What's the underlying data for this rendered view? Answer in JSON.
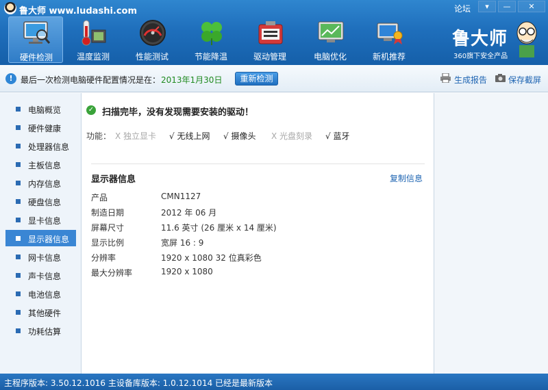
{
  "app": {
    "title": "鲁大师 www.ludashi.com",
    "forum_link": "论坛",
    "menu_btn": "▾",
    "min_btn": "—",
    "close_btn": "✕"
  },
  "nav": {
    "items": [
      {
        "label": "硬件检测",
        "icon": "monitor-magnifier-icon",
        "active": true
      },
      {
        "label": "温度监测",
        "icon": "thermometer-icon",
        "active": false
      },
      {
        "label": "性能测试",
        "icon": "speedometer-icon",
        "active": false
      },
      {
        "label": "节能降温",
        "icon": "clover-icon",
        "active": false
      },
      {
        "label": "驱动管理",
        "icon": "driver-box-icon",
        "active": false
      },
      {
        "label": "电脑优化",
        "icon": "optimize-monitor-icon",
        "active": false
      },
      {
        "label": "新机推荐",
        "icon": "award-computer-icon",
        "active": false
      }
    ]
  },
  "brand": {
    "name": "鲁大师",
    "subtitle": "360旗下安全产品"
  },
  "infobar": {
    "text": "最后一次检测电脑硬件配置情况是在：",
    "date": "2013年1月30日",
    "recheck_button": "重新检测",
    "report_link": "生成报告",
    "screenshot_link": "保存截屏"
  },
  "sidebar": {
    "items": [
      {
        "label": "电脑概览",
        "active": false
      },
      {
        "label": "硬件健康",
        "active": false
      },
      {
        "label": "处理器信息",
        "active": false
      },
      {
        "label": "主板信息",
        "active": false
      },
      {
        "label": "内存信息",
        "active": false
      },
      {
        "label": "硬盘信息",
        "active": false
      },
      {
        "label": "显卡信息",
        "active": false
      },
      {
        "label": "显示器信息",
        "active": true
      },
      {
        "label": "网卡信息",
        "active": false
      },
      {
        "label": "声卡信息",
        "active": false
      },
      {
        "label": "电池信息",
        "active": false
      },
      {
        "label": "其他硬件",
        "active": false
      },
      {
        "label": "功耗估算",
        "active": false
      }
    ]
  },
  "main": {
    "scan_message": "扫描完毕，没有发现需要安装的驱动！",
    "features_label": "功能：",
    "features": [
      {
        "text": "X 独立显卡",
        "supported": false
      },
      {
        "text": "√ 无线上网",
        "supported": true
      },
      {
        "text": "√ 摄像头",
        "supported": true
      },
      {
        "text": "X 光盘刻录",
        "supported": false
      },
      {
        "text": "√ 蓝牙",
        "supported": true
      }
    ],
    "section_title": "显示器信息",
    "copy_link": "复制信息",
    "rows": [
      {
        "label": "产品",
        "value": "CMN1127"
      },
      {
        "label": "制造日期",
        "value": "2012 年 06 月"
      },
      {
        "label": "屏幕尺寸",
        "value": "11.6 英寸 (26 厘米 x 14 厘米)"
      },
      {
        "label": "显示比例",
        "value": "宽屏 16 : 9"
      },
      {
        "label": "分辨率",
        "value": "1920 x 1080 32 位真彩色"
      },
      {
        "label": "最大分辨率",
        "value": "1920 x 1080"
      }
    ]
  },
  "status": {
    "text": "主程序版本: 3.50.12.1016   主设备库版本: 1.0.12.1014   已经是最新版本"
  },
  "colors": {
    "topbar": "#1f6fbc",
    "accent": "#3a86d4",
    "date_green": "#1f8a1f",
    "link_blue": "#1e64b2"
  }
}
